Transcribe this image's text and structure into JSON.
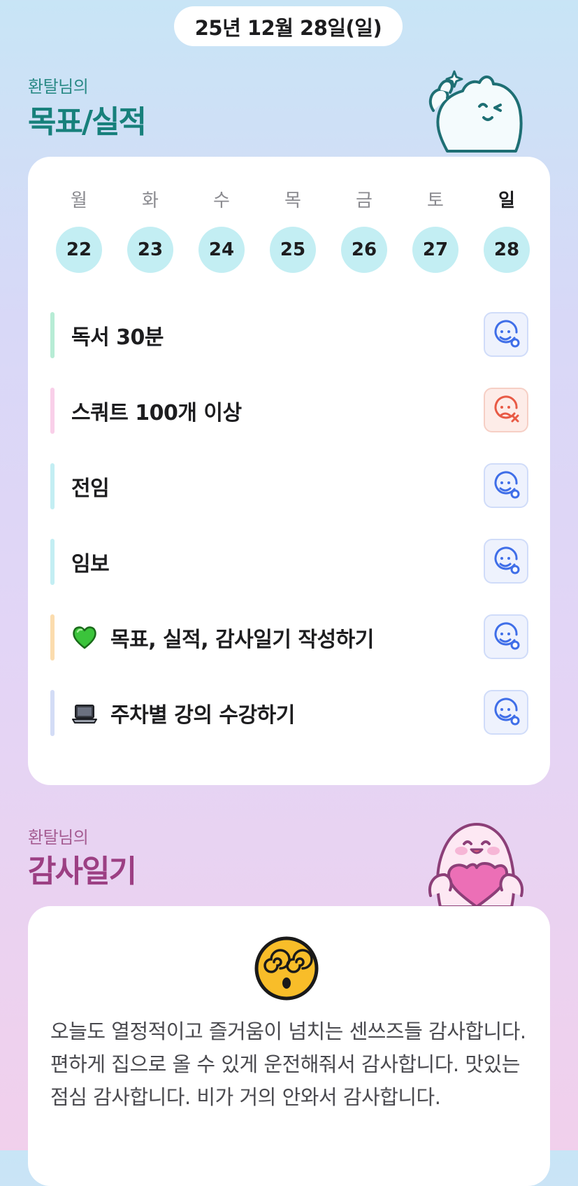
{
  "header": {
    "date": "25년 12월 28일(일)"
  },
  "goals_section": {
    "subtitle": "환탈님의",
    "title": "목표/실적"
  },
  "week": {
    "days": [
      {
        "name": "월",
        "num": "22"
      },
      {
        "name": "화",
        "num": "23"
      },
      {
        "name": "수",
        "num": "24"
      },
      {
        "name": "목",
        "num": "25"
      },
      {
        "name": "금",
        "num": "26"
      },
      {
        "name": "토",
        "num": "27"
      },
      {
        "name": "일",
        "num": "28"
      }
    ],
    "today_index": 6
  },
  "goals": [
    {
      "label": "독서 30분",
      "bar_color": "#b7ecd5",
      "status": "done",
      "icon": "smile-face-icon"
    },
    {
      "label": "스쿼트 100개 이상",
      "bar_color": "#f9cfe9",
      "status": "fail",
      "icon": "sad-face-icon"
    },
    {
      "label": "전임",
      "bar_color": "#c3eef3",
      "status": "done",
      "icon": "smile-face-icon"
    },
    {
      "label": "임보",
      "bar_color": "#c3eef3",
      "status": "done",
      "icon": "smile-face-icon"
    },
    {
      "label": "목표, 실적, 감사일기 작성하기",
      "emoji": "green-heart-icon",
      "bar_color": "#fbdcae",
      "status": "done",
      "icon": "smile-face-icon"
    },
    {
      "label": "주차별 강의 수강하기",
      "emoji": "laptop-icon",
      "bar_color": "#d3dcf6",
      "status": "done",
      "icon": "smile-face-icon"
    }
  ],
  "gratitude_section": {
    "subtitle": "환탈님의",
    "title": "감사일기",
    "mood_icon": "dizzy-face-icon",
    "text": "오늘도 열정적이고 즐거움이 넘치는 센쓰즈들 감사합니다. 편하게 집으로 올 수 있게 운전해줘서 감사합니다. 맛있는 점심 감사합니다. 비가 거의 안와서 감사합니다."
  },
  "colors": {
    "done_icon": "#3f6ee8",
    "fail_icon": "#e85a45",
    "day_circle": "#c3eef3",
    "goals_title": "#17807b",
    "gratitude_title": "#9c3f83"
  }
}
